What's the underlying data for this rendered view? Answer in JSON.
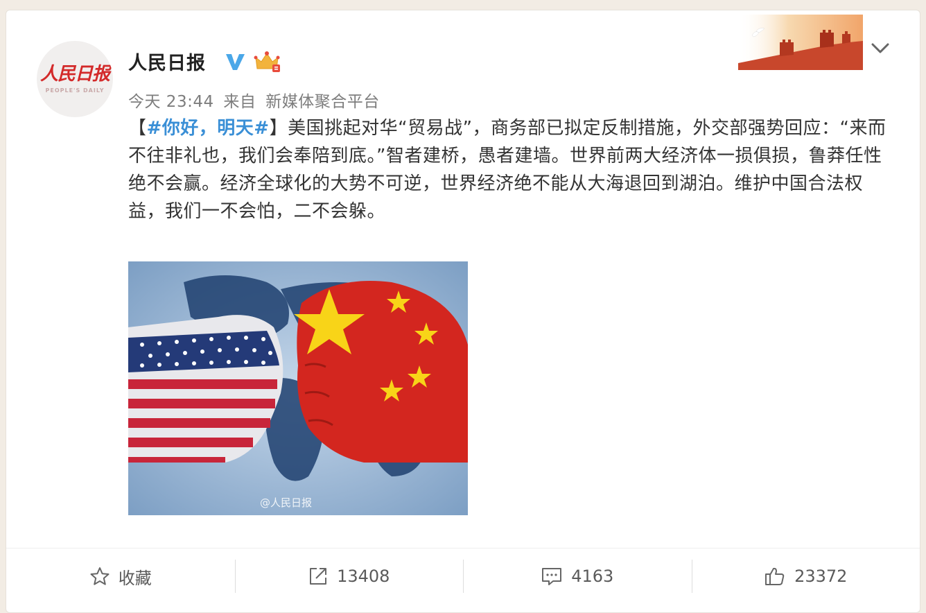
{
  "post": {
    "author": {
      "name": "人民日报",
      "avatar_text": "人民日报",
      "avatar_subtext": "PEOPLE'S DAILY"
    },
    "meta": {
      "time": "今天 23:44",
      "source_prefix": "来自",
      "source": "新媒体聚合平台"
    },
    "content": {
      "bracket_open": "【",
      "hashtag": "#你好，明天#",
      "bracket_close": "】",
      "text": "美国挑起对华“贸易战”，商务部已拟定反制措施，外交部强势回应：“来而不往非礼也，我们会奉陪到底。”智者建桥，愚者建墙。世界前两大经济体一损俱损，鲁莽任性绝不会赢。经济全球化的大势不可逆，世界经济绝不能从大海退回到湖泊。维护中国合法权益，我们一不会怕，二不会躲。"
    },
    "image": {
      "watermark": "@人民日报"
    }
  },
  "actions": {
    "favorite_label": "收藏",
    "repost_count": "13408",
    "comment_count": "4163",
    "like_count": "23372"
  },
  "icons": {
    "verified": "verified-v-icon",
    "vip": "crown-icon",
    "menu": "chevron-down-icon",
    "favorite": "star-icon",
    "repost": "share-arrow-icon",
    "comment": "comment-bubble-icon",
    "like": "thumbs-up-icon"
  },
  "colors": {
    "hashtag": "#3a8fd6",
    "verified": "#4aa7e8",
    "logo_red": "#d32a2a"
  }
}
